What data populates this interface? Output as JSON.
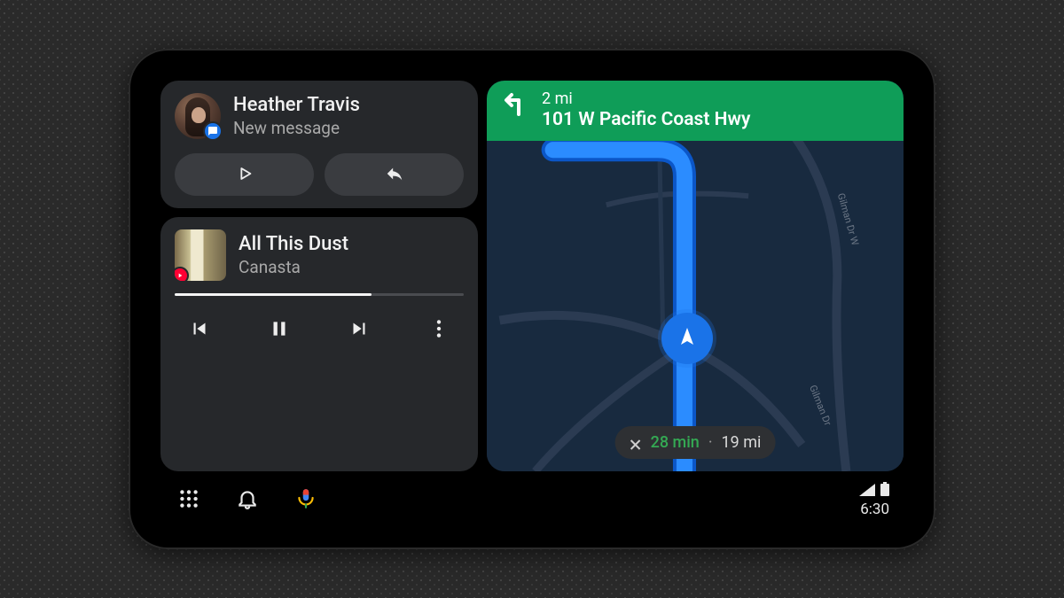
{
  "notification": {
    "sender": "Heather Travis",
    "subtitle": "New message"
  },
  "media": {
    "track": "All This Dust",
    "artist": "Canasta",
    "progress_pct": 68
  },
  "navigation": {
    "distance": "2 mi",
    "road": "101 W Pacific Coast Hwy",
    "eta_minutes": "28 min",
    "eta_distance": "19 mi",
    "road_labels": {
      "gilman_w": "Gilman Dr W",
      "gilman": "Gilman Dr"
    }
  },
  "statusbar": {
    "time": "6:30"
  },
  "colors": {
    "accent_green": "#0f9d58",
    "accent_blue": "#1a73e8",
    "eta_green": "#34a853"
  }
}
